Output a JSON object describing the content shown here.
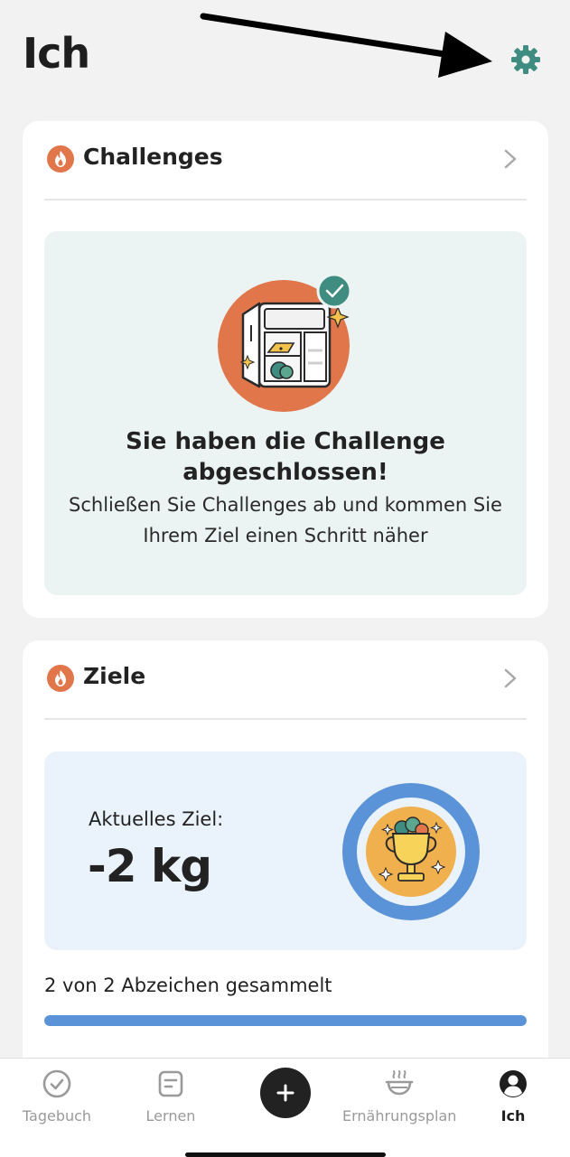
{
  "header": {
    "title": "Ich"
  },
  "challenges": {
    "title": "Challenges",
    "completed_title": "Sie haben die Challenge abgeschlossen!",
    "completed_subtitle": "Schließen Sie Challenges ab und kommen Sie Ihrem Ziel einen Schritt näher"
  },
  "goals": {
    "title": "Ziele",
    "current_goal_label": "Aktuelles Ziel:",
    "current_goal_value": "-2 kg",
    "badges_text": "2 von 2 Abzeichen gesammelt",
    "badges_collected": 2,
    "badges_total": 2,
    "progress_fraction": 1.0
  },
  "tabbar": {
    "items": [
      {
        "label": "Tagebuch",
        "icon": "check-circle-icon"
      },
      {
        "label": "Lernen",
        "icon": "document-icon"
      },
      {
        "label": "",
        "icon": "plus-icon"
      },
      {
        "label": "Ernährungsplan",
        "icon": "steaming-bowl-icon"
      },
      {
        "label": "Ich",
        "icon": "profile-icon"
      }
    ],
    "active_index": 4
  },
  "colors": {
    "accent_teal": "#3f8c80",
    "flame_orange": "#e0764a",
    "progress_blue": "#5b93d8",
    "challenge_panel_bg": "#ebf4f2",
    "goal_panel_bg": "#eaf2fc"
  }
}
